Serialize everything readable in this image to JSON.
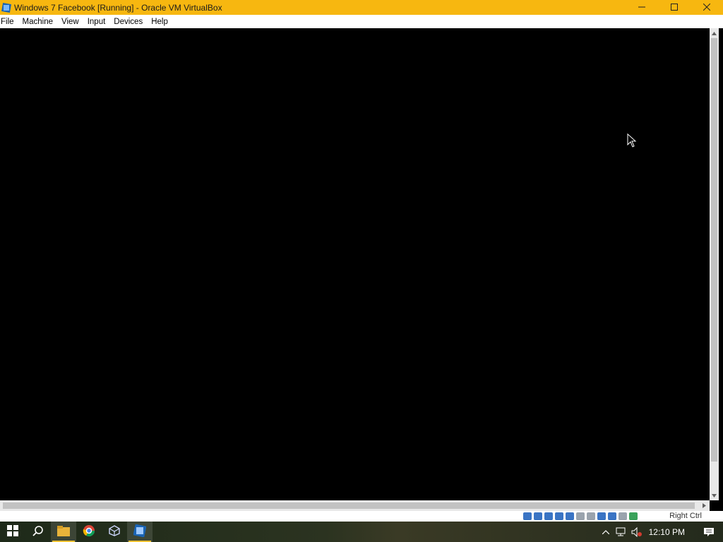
{
  "window": {
    "title": "Windows 7 Facebook [Running] - Oracle VM VirtualBox",
    "accent_color": "#f7b710",
    "icons": [
      "virtualbox-icon",
      "minimize-icon",
      "maximize-icon",
      "close-icon"
    ]
  },
  "menubar": {
    "items": [
      "File",
      "Machine",
      "View",
      "Input",
      "Devices",
      "Help"
    ]
  },
  "statusbar": {
    "host_key": "Right Ctrl",
    "icons": [
      "hard-disk-icon",
      "optical-drive-icon",
      "audio-icon",
      "network-icon",
      "usb-icon",
      "shared-folders-icon",
      "display-icon",
      "video-capture-icon",
      "virtualization-icon",
      "mouse-integration-icon",
      "keyboard-icon"
    ]
  },
  "taskbar": {
    "apps": [
      "start-icon",
      "search-icon",
      "file-explorer-icon",
      "chrome-icon",
      "virtualbox-manager-icon",
      "virtualbox-vm-icon"
    ],
    "clock": "12:10 PM",
    "tray_icons": [
      "chevron-up-icon",
      "network-icon",
      "volume-muted-icon",
      "action-center-icon"
    ]
  }
}
